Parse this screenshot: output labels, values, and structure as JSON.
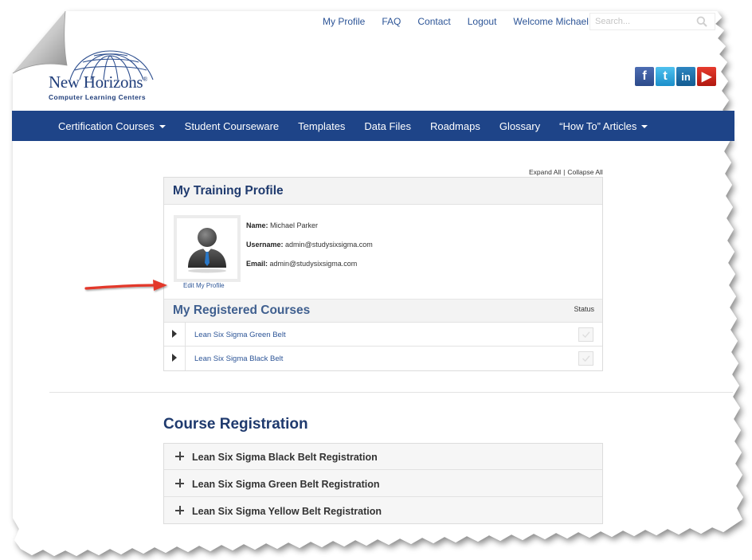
{
  "utility_nav": {
    "my_profile": "My Profile",
    "faq": "FAQ",
    "contact": "Contact",
    "logout": "Logout",
    "welcome": "Welcome Michael"
  },
  "search": {
    "placeholder": "Search..."
  },
  "logo": {
    "name": "New Horizons",
    "registered": "®",
    "tagline": "Computer Learning Centers"
  },
  "social": {
    "facebook": "f",
    "twitter": "t",
    "linkedin": "in",
    "youtube": "▶"
  },
  "main_nav": {
    "items": [
      {
        "label": "Certification Courses",
        "dropdown": true
      },
      {
        "label": "Student Courseware",
        "dropdown": false
      },
      {
        "label": "Templates",
        "dropdown": false
      },
      {
        "label": "Data Files",
        "dropdown": false
      },
      {
        "label": "Roadmaps",
        "dropdown": false
      },
      {
        "label": "Glossary",
        "dropdown": false
      },
      {
        "label": "“How To” Articles",
        "dropdown": true
      }
    ]
  },
  "expand_controls": {
    "expand_all": "Expand All",
    "separator": "|",
    "collapse_all": "Collapse All"
  },
  "training_profile": {
    "title": "My Training Profile",
    "edit_link": "Edit My Profile",
    "name_label": "Name:",
    "name_value": "Michael Parker",
    "username_label": "Username:",
    "username_value": "admin@studysixsigma.com",
    "email_label": "Email:",
    "email_value": "admin@studysixsigma.com"
  },
  "registered_courses": {
    "title": "My Registered Courses",
    "status_header": "Status",
    "courses": [
      {
        "name": "Lean Six Sigma Green Belt"
      },
      {
        "name": "Lean Six Sigma Black Belt"
      }
    ]
  },
  "course_registration": {
    "title": "Course Registration",
    "items": [
      {
        "label": "Lean Six Sigma Black Belt Registration"
      },
      {
        "label": "Lean Six Sigma Green Belt Registration"
      },
      {
        "label": "Lean Six Sigma Yellow Belt Registration"
      }
    ]
  },
  "colors": {
    "nav_blue": "#1e4488",
    "link_blue": "#2d5597",
    "heading_blue": "#1f3a6e",
    "annotation_red": "#e3392b"
  }
}
